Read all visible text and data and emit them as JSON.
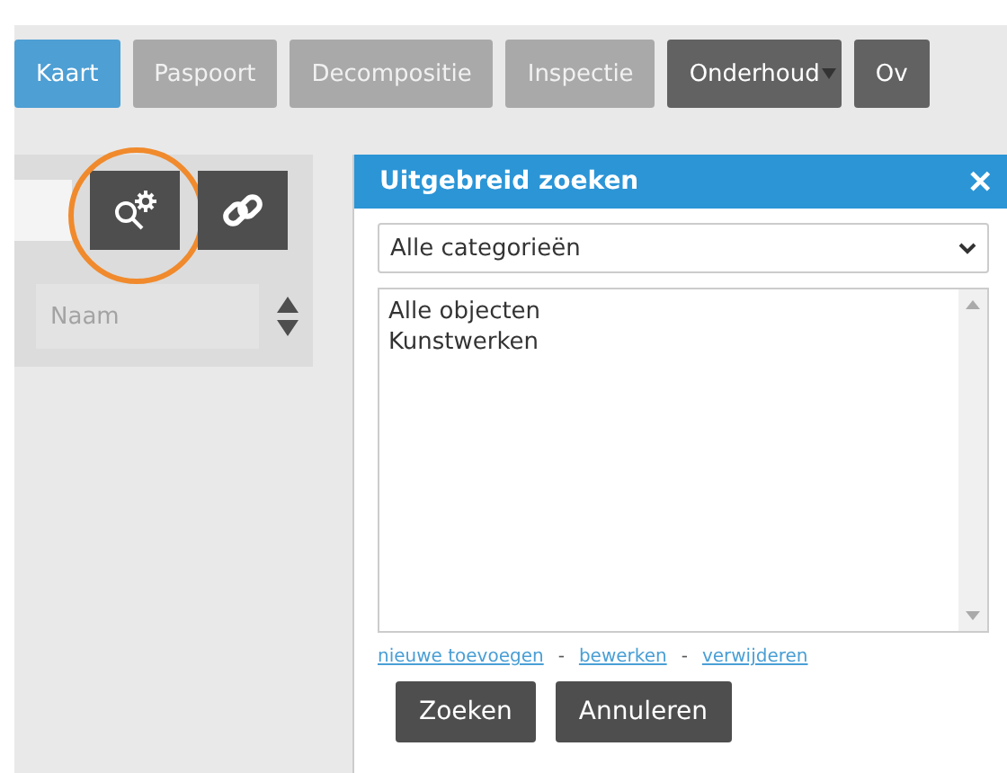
{
  "tabs": [
    {
      "label": "Kaart",
      "selected": true,
      "disabled": false,
      "has_menu": false
    },
    {
      "label": "Paspoort",
      "selected": false,
      "disabled": true,
      "has_menu": false
    },
    {
      "label": "Decompositie",
      "selected": false,
      "disabled": true,
      "has_menu": false
    },
    {
      "label": "Inspectie",
      "selected": false,
      "disabled": true,
      "has_menu": false
    },
    {
      "label": "Onderhoud",
      "selected": false,
      "disabled": false,
      "has_menu": true
    },
    {
      "label": "Ov",
      "selected": false,
      "disabled": false,
      "has_menu": false
    }
  ],
  "search_panel": {
    "advanced_search_highlighted": true,
    "sort": {
      "placeholder": "Naam"
    }
  },
  "dialog": {
    "title": "Uitgebreid zoeken",
    "close": "✕",
    "category": "Alle categorieën",
    "items": [
      "Alle objecten",
      "Kunstwerken"
    ],
    "links": [
      {
        "label": "nieuwe toevoegen"
      },
      {
        "label": "bewerken"
      },
      {
        "label": "verwijderen"
      }
    ],
    "separator": "-",
    "buttons": [
      "Zoeken",
      "Annuleren"
    ]
  }
}
